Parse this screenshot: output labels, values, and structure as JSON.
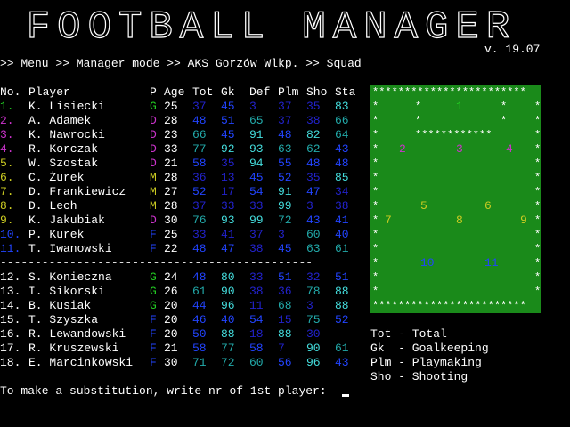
{
  "logo_text": "FOOTBALL MANAGER",
  "version": "v. 19.07",
  "breadcrumb": ">> Menu >> Manager mode >> AKS Gorzów Wlkp. >> Squad",
  "headers": {
    "no": "No.",
    "player": "Player",
    "p": "P",
    "age": "Age",
    "tot": "Tot",
    "gk": "Gk",
    "def": "Def",
    "plm": "Plm",
    "sho": "Sho",
    "sta": "Sta"
  },
  "colors": {
    "G": "#22cc22",
    "D": "#cc33cc",
    "M": "#cccc22",
    "F": "#2244ff"
  },
  "rows": [
    {
      "no": "1.",
      "name": "K. Lisiecki",
      "pos": "G",
      "age": "25",
      "tot": "37",
      "gk": "45",
      "def": "3",
      "plm": "37",
      "sho": "35",
      "sta": "83",
      "c": [
        "#2222cc",
        "#2244ff",
        "#2222cc",
        "#2222cc",
        "#2222cc",
        "#44dddd"
      ]
    },
    {
      "no": "2.",
      "name": "A. Adamek",
      "pos": "D",
      "age": "28",
      "tot": "48",
      "gk": "51",
      "def": "65",
      "plm": "37",
      "sho": "38",
      "sta": "66",
      "c": [
        "#2244ff",
        "#2244ff",
        "#22aaaa",
        "#2222cc",
        "#2222cc",
        "#22aaaa"
      ]
    },
    {
      "no": "3.",
      "name": "K. Nawrocki",
      "pos": "D",
      "age": "23",
      "tot": "66",
      "gk": "45",
      "def": "91",
      "plm": "48",
      "sho": "82",
      "sta": "64",
      "c": [
        "#22aaaa",
        "#2244ff",
        "#44dddd",
        "#2244ff",
        "#44dddd",
        "#22aaaa"
      ]
    },
    {
      "no": "4.",
      "name": "R. Korczak",
      "pos": "D",
      "age": "33",
      "tot": "77",
      "gk": "92",
      "def": "93",
      "plm": "63",
      "sho": "62",
      "sta": "43",
      "c": [
        "#22aaaa",
        "#44dddd",
        "#44dddd",
        "#22aaaa",
        "#22aaaa",
        "#2244ff"
      ]
    },
    {
      "no": "5.",
      "name": "W. Szostak",
      "pos": "D",
      "age": "21",
      "tot": "58",
      "gk": "35",
      "def": "94",
      "plm": "55",
      "sho": "48",
      "sta": "48",
      "c": [
        "#2244ff",
        "#2222cc",
        "#44dddd",
        "#2244ff",
        "#2244ff",
        "#2244ff"
      ]
    },
    {
      "no": "6.",
      "name": "C. Żurek",
      "pos": "M",
      "age": "28",
      "tot": "36",
      "gk": "13",
      "def": "45",
      "plm": "52",
      "sho": "35",
      "sta": "85",
      "c": [
        "#2222cc",
        "#2222cc",
        "#2244ff",
        "#2244ff",
        "#2222cc",
        "#44dddd"
      ]
    },
    {
      "no": "7.",
      "name": "D. Frankiewicz",
      "pos": "M",
      "age": "27",
      "tot": "52",
      "gk": "17",
      "def": "54",
      "plm": "91",
      "sho": "47",
      "sta": "34",
      "c": [
        "#2244ff",
        "#2222cc",
        "#2244ff",
        "#44dddd",
        "#2244ff",
        "#2222cc"
      ]
    },
    {
      "no": "8.",
      "name": "D. Lech",
      "pos": "M",
      "age": "28",
      "tot": "37",
      "gk": "33",
      "def": "33",
      "plm": "99",
      "sho": "3",
      "sta": "38",
      "c": [
        "#2222cc",
        "#2222cc",
        "#2222cc",
        "#44dddd",
        "#2222cc",
        "#2222cc"
      ]
    },
    {
      "no": "9.",
      "name": "K. Jakubiak",
      "pos": "D",
      "age": "30",
      "tot": "76",
      "gk": "93",
      "def": "99",
      "plm": "72",
      "sho": "43",
      "sta": "41",
      "c": [
        "#22aaaa",
        "#44dddd",
        "#44dddd",
        "#22aaaa",
        "#2244ff",
        "#2244ff"
      ]
    },
    {
      "no": "10.",
      "name": "P. Kurek",
      "pos": "F",
      "age": "25",
      "tot": "33",
      "gk": "41",
      "def": "37",
      "plm": "3",
      "sho": "60",
      "sta": "40",
      "c": [
        "#2222cc",
        "#2222cc",
        "#2222cc",
        "#2222cc",
        "#22aaaa",
        "#2244ff"
      ]
    },
    {
      "no": "11.",
      "name": "T. Iwanowski",
      "pos": "F",
      "age": "22",
      "tot": "48",
      "gk": "47",
      "def": "38",
      "plm": "45",
      "sho": "63",
      "sta": "61",
      "c": [
        "#2244ff",
        "#2244ff",
        "#2222cc",
        "#2244ff",
        "#22aaaa",
        "#22aaaa"
      ]
    },
    {
      "no": "12.",
      "name": "S. Konieczna",
      "pos": "G",
      "age": "24",
      "tot": "48",
      "gk": "80",
      "def": "33",
      "plm": "51",
      "sho": "32",
      "sta": "51",
      "c": [
        "#2244ff",
        "#44dddd",
        "#2222cc",
        "#2244ff",
        "#2222cc",
        "#2244ff"
      ]
    },
    {
      "no": "13.",
      "name": "I. Sikorski",
      "pos": "G",
      "age": "26",
      "tot": "61",
      "gk": "90",
      "def": "38",
      "plm": "36",
      "sho": "78",
      "sta": "88",
      "c": [
        "#22aaaa",
        "#44dddd",
        "#2222cc",
        "#2222cc",
        "#22aaaa",
        "#44dddd"
      ]
    },
    {
      "no": "14.",
      "name": "B. Kusiak",
      "pos": "G",
      "age": "20",
      "tot": "44",
      "gk": "96",
      "def": "11",
      "plm": "68",
      "sho": "3",
      "sta": "88",
      "c": [
        "#2244ff",
        "#44dddd",
        "#2222cc",
        "#22aaaa",
        "#2222cc",
        "#44dddd"
      ]
    },
    {
      "no": "15.",
      "name": "T. Szyszka",
      "pos": "F",
      "age": "20",
      "tot": "46",
      "gk": "40",
      "def": "54",
      "plm": "15",
      "sho": "75",
      "sta": "52",
      "c": [
        "#2244ff",
        "#2244ff",
        "#2244ff",
        "#2222cc",
        "#22aaaa",
        "#2244ff"
      ]
    },
    {
      "no": "16.",
      "name": "R. Lewandowski",
      "pos": "F",
      "age": "20",
      "tot": "50",
      "gk": "88",
      "def": "18",
      "plm": "88",
      "sho": "30",
      "sta": "",
      "c": [
        "#2244ff",
        "#44dddd",
        "#2222cc",
        "#44dddd",
        "#2222cc",
        "#2222cc"
      ]
    },
    {
      "no": "17.",
      "name": "R. Kruszewski",
      "pos": "F",
      "age": "21",
      "tot": "58",
      "gk": "77",
      "def": "58",
      "plm": "7",
      "sho": "90",
      "sta": "61",
      "c": [
        "#2244ff",
        "#22aaaa",
        "#2244ff",
        "#2222cc",
        "#44dddd",
        "#22aaaa"
      ]
    },
    {
      "no": "18.",
      "name": "E. Marcinkowski",
      "pos": "F",
      "age": "30",
      "tot": "71",
      "gk": "72",
      "def": "60",
      "plm": "56",
      "sho": "96",
      "sta": "43",
      "c": [
        "#22aaaa",
        "#22aaaa",
        "#22aaaa",
        "#2244ff",
        "#44dddd",
        "#2244ff"
      ]
    }
  ],
  "no_colors": [
    "#22cc22",
    "#cc33cc",
    "#cc33cc",
    "#cc33cc",
    "#cccc22",
    "#cccc22",
    "#cccc22",
    "#cccc22",
    "#cccc22",
    "#2244ff",
    "#2244ff"
  ],
  "separator": "---------------------------------------------",
  "legend": [
    "Tot - Total",
    "Gk  - Goalkeeping",
    "Plm - Playmaking",
    "Sho - Shooting"
  ],
  "prompt": "To make a substitution, write nr of 1st player:",
  "pitch": {
    "border_row": "************************",
    "box_row": "************",
    "players": [
      {
        "n": "1",
        "col": "#22cc22"
      },
      {
        "n": "2",
        "col": "#cc33cc"
      },
      {
        "n": "3",
        "col": "#cc33cc"
      },
      {
        "n": "4",
        "col": "#cc33cc"
      },
      {
        "n": "5",
        "col": "#cccc22"
      },
      {
        "n": "6",
        "col": "#cccc22"
      },
      {
        "n": "7",
        "col": "#cccc22"
      },
      {
        "n": "8",
        "col": "#cccc22"
      },
      {
        "n": "9",
        "col": "#cccc22"
      },
      {
        "n": "10",
        "col": "#2244ff"
      },
      {
        "n": "11",
        "col": "#2244ff"
      }
    ]
  }
}
